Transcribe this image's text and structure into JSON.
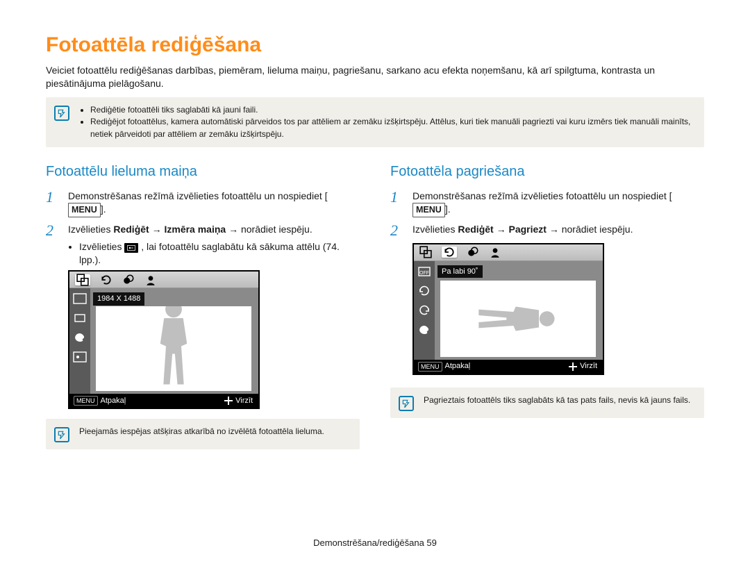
{
  "title": "Fotoattēla rediģēšana",
  "intro": "Veiciet fotoattēlu rediģēšanas darbības, piemēram, lieluma maiņu, pagriešanu, sarkano acu efekta noņemšanu, kā arī spilgtuma, kontrasta un piesātinājuma pielāgošanu.",
  "top_note_items": [
    "Rediģētie fotoattēli tiks saglabāti kā jauni faili.",
    "Rediģējot fotoattēlus, kamera automātiski pārveidos tos par attēliem ar zemāku izšķirtspēju. Attēlus, kuri tiek manuāli pagriezti vai kuru izmērs tiek manuāli mainīts, netiek pārveidoti par attēliem ar zemāku izšķirtspēju."
  ],
  "left": {
    "heading": "Fotoattēlu lieluma maiņa",
    "step1_a": "Demonstrēšanas režīmā izvēlieties fotoattēlu un nospiediet ",
    "step1_b": ".",
    "menu_label": "MENU",
    "step2_a": "Izvēlieties ",
    "step2_bold1": "Rediģēt",
    "step2_arrow": " → ",
    "step2_bold2": "Izmēra maiņa",
    "step2_b": " → norādiet iespēju.",
    "bullet_a": "Izvēlieties ",
    "bullet_b": ", lai fotoattēlu saglabātu kā sākuma attēlu (74. lpp.).",
    "screen": {
      "caption": "1984 X 1488",
      "menu": "MENU",
      "back": "Atpakaļ",
      "move": "Virzīt"
    },
    "note": "Pieejamās iespējas atšķiras atkarībā no izvēlētā fotoattēla lieluma."
  },
  "right": {
    "heading": "Fotoattēla pagriešana",
    "step1_a": "Demonstrēšanas režīmā izvēlieties fotoattēlu un nospiediet ",
    "step1_b": ".",
    "menu_label": "MENU",
    "step2_a": "Izvēlieties ",
    "step2_bold1": "Rediģēt",
    "step2_arrow": " → ",
    "step2_bold2": "Pagriezt",
    "step2_b": " → norādiet iespēju.",
    "screen": {
      "caption": "Pa labi 90˚",
      "menu": "MENU",
      "back": "Atpakaļ",
      "move": "Virzīt"
    },
    "note": "Pagrieztais fotoattēls tiks saglabāts kā tas pats fails, nevis kā jauns fails."
  },
  "footer_a": "Demonstrēšana/rediģēšana  ",
  "footer_page": "59"
}
